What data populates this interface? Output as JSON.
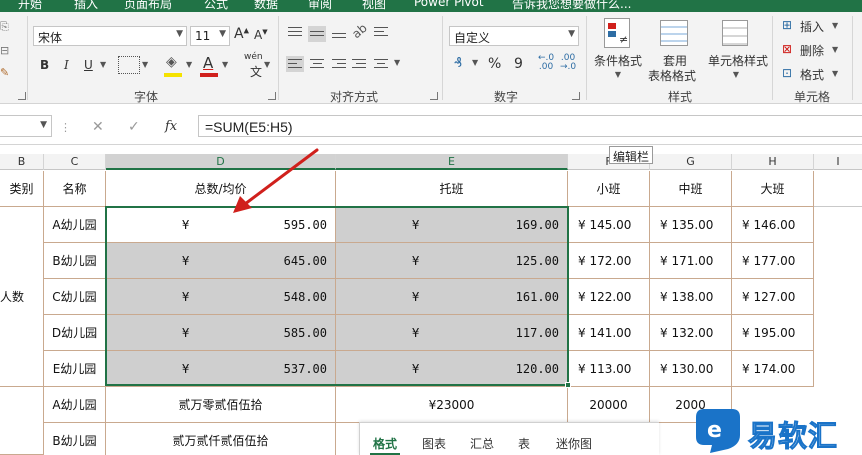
{
  "ribbon_tabs": [
    "开始",
    "插入",
    "页面布局",
    "公式",
    "数据",
    "审阅",
    "视图",
    "Power Pivot",
    "告诉我您想要做什么..."
  ],
  "ribbon": {
    "font_name": "宋体",
    "font_size": "11",
    "bold": "B",
    "italic": "I",
    "underline": "U",
    "font_color_glyph": "A",
    "phonetic": "wén",
    "group_font": "字体",
    "group_align": "对齐方式",
    "number_format": "自定义",
    "percent": "%",
    "comma": "9",
    "group_number": "数字",
    "cond_format": "条件格式",
    "table_format_l1": "套用",
    "table_format_l2": "表格格式",
    "cell_styles": "单元格样式",
    "group_styles": "样式",
    "insert": "插入",
    "delete": "删除",
    "format": "格式",
    "group_cells": "单元格"
  },
  "formula_bar": {
    "cancel_glyph": "✕",
    "enter_glyph": "✓",
    "fx": "fx",
    "formula": "=SUM(E5:H5)",
    "tooltip": "编辑栏"
  },
  "columns": [
    "B",
    "C",
    "D",
    "E",
    "F",
    "G",
    "H",
    "I"
  ],
  "header_row": {
    "b": "类别",
    "c": "名称",
    "d": "总数/均价",
    "e": "托班",
    "f": "小班",
    "g": "中班",
    "h": "大班"
  },
  "category": "人数",
  "currency": "¥",
  "rows": [
    {
      "name": "A幼儿园",
      "total": "595.00",
      "tuo": "169.00",
      "xiao": "¥ 145.00",
      "zhong": "¥ 135.00",
      "da": "¥ 146.00"
    },
    {
      "name": "B幼儿园",
      "total": "645.00",
      "tuo": "125.00",
      "xiao": "¥ 172.00",
      "zhong": "¥ 171.00",
      "da": "¥ 177.00"
    },
    {
      "name": "C幼儿园",
      "total": "548.00",
      "tuo": "161.00",
      "xiao": "¥ 122.00",
      "zhong": "¥ 138.00",
      "da": "¥ 127.00"
    },
    {
      "name": "D幼儿园",
      "total": "585.00",
      "tuo": "117.00",
      "xiao": "¥ 141.00",
      "zhong": "¥ 132.00",
      "da": "¥ 195.00"
    },
    {
      "name": "E幼儿园",
      "total": "537.00",
      "tuo": "120.00",
      "xiao": "¥ 113.00",
      "zhong": "¥ 130.00",
      "da": "¥ 174.00"
    }
  ],
  "lower_rows": [
    {
      "name": "A幼儿园",
      "total": "贰万零贰佰伍拾",
      "tuo": "¥23000",
      "xiao": "20000",
      "zhong": "2000"
    },
    {
      "name": "B幼儿园",
      "total": "贰万贰仟贰佰伍拾"
    }
  ],
  "quick_analysis": [
    "格式",
    "图表",
    "汇总",
    "表",
    "迷你图"
  ],
  "watermark": "易软汇",
  "colors": {
    "accent": "#217346",
    "arrow": "#d0201c",
    "watermark": "#1a73c8"
  }
}
